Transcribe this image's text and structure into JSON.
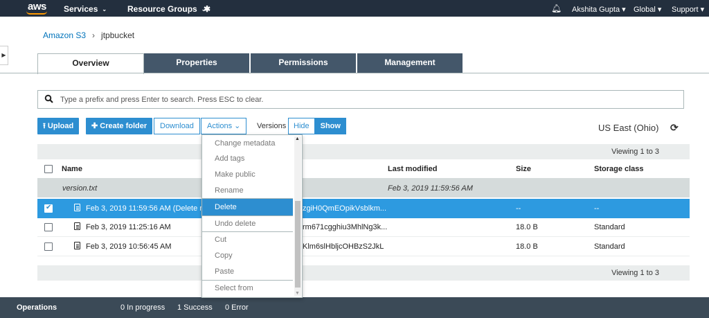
{
  "topnav": {
    "logo": "aws",
    "services": "Services",
    "resource_groups": "Resource Groups",
    "user": "Akshita Gupta",
    "region": "Global",
    "support": "Support",
    "caret": "▾"
  },
  "breadcrumb": {
    "root": "Amazon S3",
    "separator": "›",
    "bucket": "jtpbucket"
  },
  "tabs": [
    "Overview",
    "Properties",
    "Permissions",
    "Management"
  ],
  "search": {
    "placeholder": "Type a prefix and press Enter to search. Press ESC to clear."
  },
  "toolbar": {
    "upload": "Upload",
    "create_folder": "Create folder",
    "download": "Download",
    "actions": "Actions",
    "versions_label": "Versions",
    "hide": "Hide",
    "show": "Show",
    "region": "US East (Ohio)"
  },
  "table": {
    "viewing": "Viewing 1 to 3",
    "columns": {
      "name": "Name",
      "last_modified": "Last modified",
      "size": "Size",
      "storage_class": "Storage class"
    },
    "group": {
      "name": "version.txt",
      "last_modified": "Feb 3, 2019 11:59:56 AM"
    },
    "rows": [
      {
        "name": "Feb 3, 2019 11:59:56 AM (Delete mark",
        "version": "zgiH0QmEOpikVsblkm...",
        "size": "--",
        "storage_class": "--",
        "selected": true
      },
      {
        "name": "Feb 3, 2019 11:25:16 AM",
        "version": "rm671cgghiu3MhlNg3k...",
        "size": "18.0 B",
        "storage_class": "Standard",
        "selected": false
      },
      {
        "name": "Feb 3, 2019 10:56:45 AM",
        "version": "Klm6slHbljcOHBzS2JkL",
        "size": "18.0 B",
        "storage_class": "Standard",
        "selected": false
      }
    ]
  },
  "actions_menu": {
    "items": [
      "Change metadata",
      "Add tags",
      "Make public",
      "Rename",
      "Delete",
      "Undo delete",
      "Cut",
      "Copy",
      "Paste",
      "Select from"
    ],
    "highlighted": "Delete"
  },
  "footer": {
    "label": "Operations",
    "in_progress": "0 In progress",
    "success": "1 Success",
    "error": "0 Error"
  },
  "colors": {
    "nav_bg": "#232f3e",
    "tab_bg": "#44576a",
    "accent": "#2d8ed0",
    "selected_row": "#2d9ae0",
    "footer_bg": "#3b4a57"
  }
}
